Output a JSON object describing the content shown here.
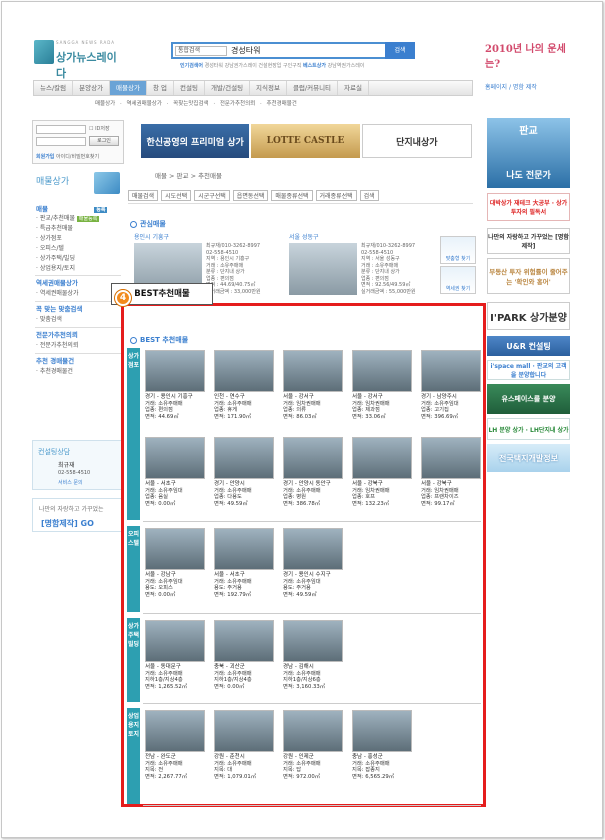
{
  "header": {
    "logo_sub": "SANGGA NEWS RADA",
    "logo_name": "상가뉴스레이다",
    "search_select": "통합검색",
    "search_keyword": "경성타워",
    "search_button": "검색",
    "quick_label1": "인기검색어",
    "quick_text1": "경성타워 강남권가스레이 건설현장입 구인구직",
    "quick_label2": "베스트상가",
    "quick_text2": "강남역권가스레이",
    "banner_text": "2010년 나의 운세는?"
  },
  "nav": {
    "items": [
      "뉴스/칼럼",
      "분양상가",
      "매물상가",
      "창 업",
      "컨설팅",
      "개발/건설팅",
      "지식정보",
      "클럽/커뮤니티",
      "자료실"
    ],
    "active_index": 2,
    "right": "홈페이지 / 명함 제작",
    "sub": "매물상가 · 역세권매물상가 · 꼭찾는맛집검색 · 전문가추천의뢰 · 추천경매물건"
  },
  "login": {
    "id_save": "ID저장",
    "login_button": "로그인",
    "join": "회원가입",
    "find": "아이디/비밀번호찾기"
  },
  "left": {
    "title": "매물상가",
    "menu_head1": "매물",
    "menu_badge1": "등록",
    "items1": [
      "판교/추천매물",
      "특급추천매물",
      "상가점포",
      "오피스/텔",
      "상가주택/빌딩",
      "상업용지/토지"
    ],
    "badge_green": "매물등록",
    "menu_head2": "역세권매물상가",
    "items2": [
      "역세권매물상가"
    ],
    "menu_head3": "꼭 맞는 맞춤검색",
    "items3": [
      "맞춤검색"
    ],
    "menu_head4": "전문가추천의뢰",
    "items4": [
      "전문가추천의뢰"
    ],
    "menu_head5": "추천 경매물건",
    "items5": [
      "추천경매물건"
    ],
    "consult_title": "컨설팅상담",
    "consult_name": "최규재",
    "consult_phone": "02-558-4510",
    "consult_sub": "서비스 문의",
    "card_text": "나만의 자랑하고 가꾸었는",
    "card_big": "[명함제작] GO"
  },
  "main": {
    "banners": [
      "한신공영의 프리미엄 상가",
      "LOTTE CASTLE",
      "단지내상가"
    ],
    "breadcrumb": "매물 > 판교 > 추천매물",
    "filters": [
      "매물검색",
      "시도선택",
      "시군구선택",
      "읍면동선택",
      "매물종류선택",
      "거래종류선택",
      "검색"
    ],
    "concern_title": "관심매물",
    "concern": [
      {
        "title": "용인시 기흥구",
        "desc": "최규재/010-3262-8997\n02-558-4510\n지역 : 용인시 기흥구\n거래 : 소유주매매\n분류 : 단지내 상가\n업종 : 편의점\n면적 : 44.69/40.75㎡\n실거래금액 : 33,000만원"
      },
      {
        "title": "서울 성동구",
        "desc": "최규재/010-3262-8997\n02-558-4510\n지역 : 서울 성동구\n거래 : 소유주매매\n분류 : 단지내 상가\n업종 : 편의점\n면적 : 92.56/49.59㎡\n실거래금액 : 55,000만원"
      }
    ],
    "side_links": [
      "맞춤형 찾기",
      "역세권 찾기"
    ],
    "tooltip": "BEST추천매물",
    "marker": "4",
    "best_title": "BEST 추천매물"
  },
  "best": [
    {
      "category": "상가점포",
      "items": [
        [
          "경기 - 용인시 기흥구",
          "거래: 소유주매매",
          "업종: 편의점",
          "면적: 44.69㎡"
        ],
        [
          "인천 - 연수구",
          "거래: 소유주매매",
          "업종: 휴게",
          "면적: 171.90㎡"
        ],
        [
          "서울 - 강서구",
          "거래: 임차권매매",
          "업종: 의류",
          "면적: 86.03㎡"
        ],
        [
          "서울 - 강서구",
          "거래: 임차권매매",
          "업종: 제과점",
          "면적: 33.06㎡"
        ],
        [
          "경기 - 남양주시",
          "거래: 소유주임대",
          "업종: 고기집",
          "면적: 396.69㎡"
        ],
        [
          "서울 - 서초구",
          "거래: 소유주임대",
          "업종: 음실",
          "면적: 0.00㎡"
        ],
        [
          "경기 - 안양시",
          "거래: 소유주매매",
          "업종: 다용도",
          "면적: 49.59㎡"
        ],
        [
          "경기 - 안양시 동안구",
          "거래: 소유주매매",
          "업종: 병원",
          "면적: 386.78㎡"
        ],
        [
          "서울 - 강북구",
          "거래: 임차권매매",
          "업종: 호프",
          "면적: 132.23㎡"
        ],
        [
          "서울 - 강북구",
          "거래: 임차권매매",
          "업종: 프랜차이즈",
          "면적: 99.17㎡"
        ]
      ]
    },
    {
      "category": "오피스텔",
      "items": [
        [
          "서울 - 강남구",
          "거래: 소유주임대",
          "용도: 오피스",
          "면적: 0.00㎡"
        ],
        [
          "서울 - 서초구",
          "거래: 소유주매매",
          "용도: 주거용",
          "면적: 192.79㎡"
        ],
        [
          "경기 - 용인시 수지구",
          "거래: 소유주임대",
          "용도: 주거용",
          "면적: 49.59㎡"
        ]
      ]
    },
    {
      "category": "상가주택빌딩",
      "items": [
        [
          "서울 - 동대문구",
          "거래: 소유주매매",
          "지하1층/지상4층",
          "면적: 1,265.52㎡"
        ],
        [
          "충북 - 괴산군",
          "거래: 소유주매매",
          "지하1층/지상4층",
          "면적: 0.00㎡"
        ],
        [
          "경남 - 김해시",
          "거래: 소유주매매",
          "지하1층/지상6층",
          "면적: 3,160.33㎡"
        ]
      ]
    },
    {
      "category": "상업용지토지",
      "items": [
        [
          "전남 - 완도군",
          "거래: 소유주매매",
          "지목: 전",
          "면적: 2,267.77㎡"
        ],
        [
          "강원 - 춘천시",
          "거래: 소유주매매",
          "지목: 대",
          "면적: 1,079.01㎡"
        ],
        [
          "강원 - 인제군",
          "거래: 소유주매매",
          "지목: 답",
          "면적: 972.00㎡"
        ],
        [
          "충남 - 홍성군",
          "거래: 소유주매매",
          "지목: 잡종지",
          "면적: 6,565.29㎡"
        ]
      ]
    }
  ],
  "right": {
    "r1": "판교",
    "r1n": "나도 전문가",
    "r2": "대박상가 재테크 大공부 · 상가투자의 필독서",
    "r3": "나만의 자랑하고 가꾸었는 [명함제작]",
    "r4": "부동산 투자 위험률이 줄어주는 '확인와 홍어'",
    "r5": "I'PARK 상가분양",
    "r6": "U&R 컨설팅",
    "r7": "i'space mall · 판교의 고객을 분양합니다",
    "r8": "유스페이스를 분양",
    "r9": "LH 분양 상가 · LH단지내 상가",
    "r10": "전국택지개발정보"
  }
}
